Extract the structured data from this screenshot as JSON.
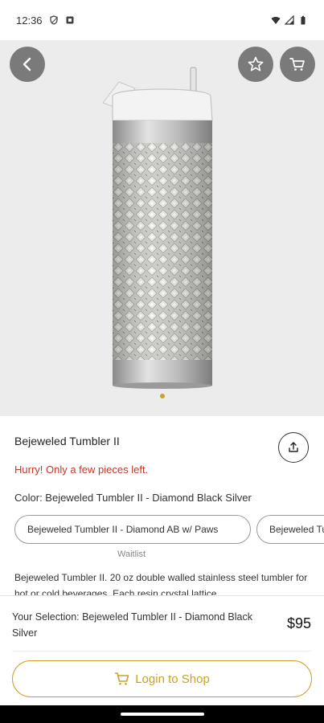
{
  "status_bar": {
    "time": "12:36",
    "icons": [
      "shield-icon",
      "app-notification-icon",
      "wifi-icon",
      "signal-icon",
      "battery-icon"
    ]
  },
  "gallery": {
    "slide_count": 1,
    "active_index": 0,
    "back_icon": "arrow-back-icon",
    "favorite_icon": "star-outline-icon",
    "cart_icon": "cart-icon"
  },
  "product": {
    "name": "Bejeweled Tumbler II",
    "urgency": "Hurry! Only a few pieces left.",
    "color_label": "Color: Bejeweled Tumbler II - Diamond Black Silver",
    "options": [
      {
        "label": "Bejeweled Tumbler II - Diamond AB w/ Paws",
        "note": "Waitlist"
      },
      {
        "label": "Bejeweled Tumbler II - Diamond Black Silver"
      }
    ],
    "description": "Bejeweled Tumbler II. 20 oz double walled stainless steel tumbler for hot or cold beverages. Each resin crystal lattice"
  },
  "footer": {
    "selection_text": "Your Selection: Bejeweled Tumbler II - Diamond Black Silver",
    "price": "$95",
    "login_label": "Login to Shop"
  },
  "colors": {
    "accent": "#c9a227",
    "urgency": "#c0392b",
    "icon_button_bg": "#7a7a7a"
  }
}
